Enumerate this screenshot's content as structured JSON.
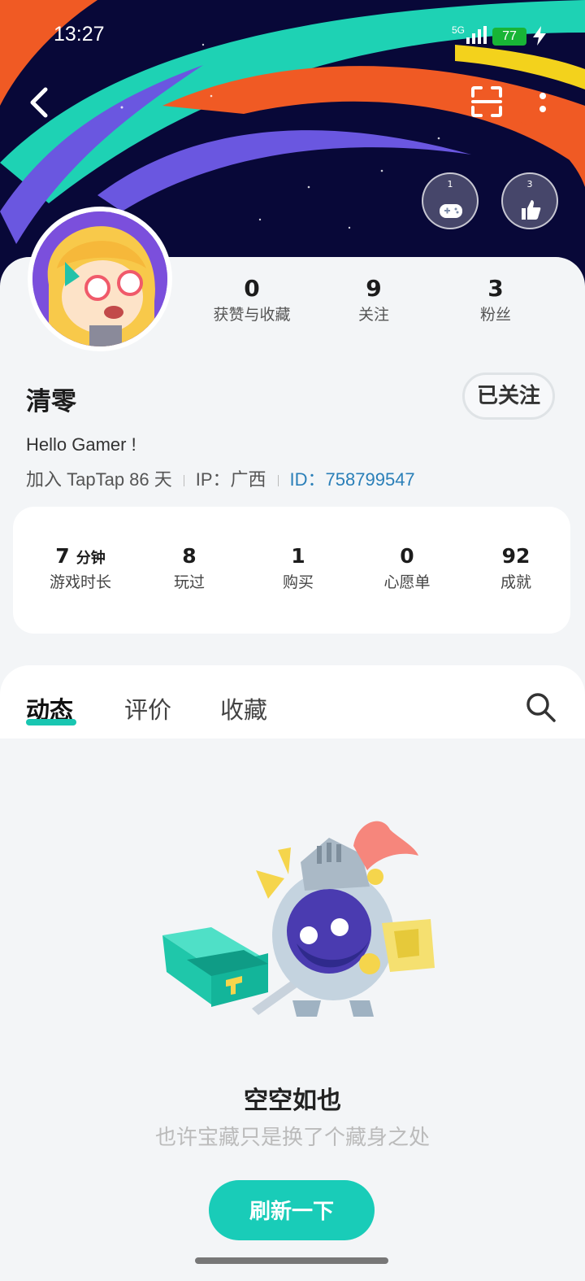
{
  "status_bar": {
    "time": "13:27",
    "network": "5G",
    "battery": "77"
  },
  "profile": {
    "name": "清零",
    "follow_button": "已关注",
    "bio": "Hello Gamer !",
    "joined": "加入 TapTap 86 天",
    "ip": "IP：广西",
    "id": "ID：758799547",
    "stats": [
      {
        "value": "0",
        "label": "获赞与收藏"
      },
      {
        "value": "9",
        "label": "关注"
      },
      {
        "value": "3",
        "label": "粉丝"
      }
    ],
    "badges": [
      {
        "level": "1"
      },
      {
        "level": "3"
      }
    ]
  },
  "game_stats": [
    {
      "value": "7",
      "unit": "分钟",
      "label": "游戏时长"
    },
    {
      "value": "8",
      "label": "玩过"
    },
    {
      "value": "1",
      "label": "购买"
    },
    {
      "value": "0",
      "label": "心愿单"
    },
    {
      "value": "92",
      "label": "成就"
    }
  ],
  "tabs": [
    {
      "label": "动态",
      "active": true
    },
    {
      "label": "评价",
      "active": false
    },
    {
      "label": "收藏",
      "active": false
    }
  ],
  "empty_state": {
    "title": "空空如也",
    "subtitle": "也许宝藏只是换了个藏身之处",
    "button": "刷新一下"
  },
  "colors": {
    "accent": "#19ccb8",
    "id_link": "#2a7fb8",
    "banner_bg": "#0a0a3c"
  }
}
